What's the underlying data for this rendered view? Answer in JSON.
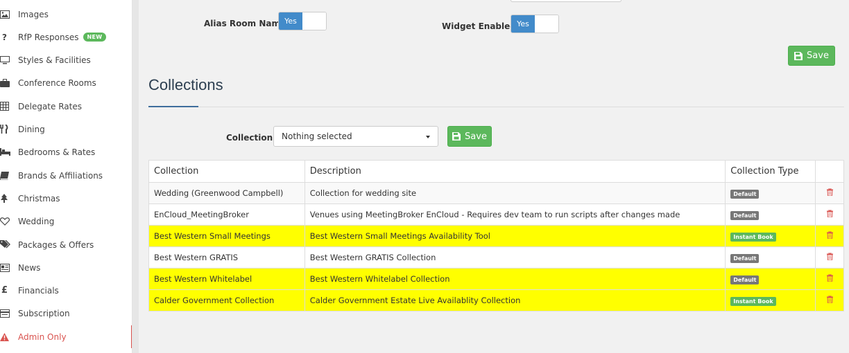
{
  "sidebar": {
    "items": [
      {
        "label": "Images",
        "icon": "image-icon"
      },
      {
        "label": "RfP Responses",
        "icon": "question-icon",
        "badge": "NEW"
      },
      {
        "label": "Styles & Facilities",
        "icon": "monitor-icon"
      },
      {
        "label": "Conference Rooms",
        "icon": "briefcase-icon"
      },
      {
        "label": "Delegate Rates",
        "icon": "calendar-grid-icon"
      },
      {
        "label": "Dining",
        "icon": "cutlery-icon"
      },
      {
        "label": "Bedrooms & Rates",
        "icon": "bed-icon"
      },
      {
        "label": "Brands & Affiliations",
        "icon": "book-icon"
      },
      {
        "label": "Christmas",
        "icon": "tree-icon"
      },
      {
        "label": "Wedding",
        "icon": "heart-icon"
      },
      {
        "label": "Packages & Offers",
        "icon": "tags-icon"
      },
      {
        "label": "News",
        "icon": "newspaper-icon"
      },
      {
        "label": "Financials",
        "icon": "pound-icon"
      },
      {
        "label": "Subscription",
        "icon": "list-icon"
      },
      {
        "label": "Admin Only",
        "icon": "warning-icon",
        "active": true
      }
    ]
  },
  "settings": {
    "alias_room_name_label": "Alias Room Name",
    "alias_room_name_value": "Yes",
    "widget_enabled_label": "Widget Enabled",
    "widget_enabled_value": "Yes",
    "save_label": "Save"
  },
  "collections": {
    "title": "Collections",
    "select_label": "Collection",
    "select_value": "Nothing selected",
    "save_label": "Save",
    "table": {
      "headers": [
        "Collection",
        "Description",
        "Collection Type"
      ],
      "rows": [
        {
          "collection": "Wedding (Greenwood Campbell)",
          "description": "Collection for wedding site",
          "type": "Default",
          "highlight": false
        },
        {
          "collection": "EnCloud_MeetingBroker",
          "description": "Venues using MeetingBroker EnCloud - Requires dev team to run scripts after changes made",
          "type": "Default",
          "highlight": false
        },
        {
          "collection": "Best Western Small Meetings",
          "description": "Best Western Small Meetings Availability Tool",
          "type": "Instant Book",
          "highlight": true
        },
        {
          "collection": "Best Western GRATIS",
          "description": "Best Western GRATIS Collection",
          "type": "Default",
          "highlight": false
        },
        {
          "collection": "Best Western Whitelabel",
          "description": "Best Western Whitelabel Collection",
          "type": "Default",
          "highlight": true
        },
        {
          "collection": "Calder Government Collection",
          "description": "Calder Government Estate Live Availablity Collection",
          "type": "Instant Book",
          "highlight": true
        }
      ]
    }
  },
  "colors": {
    "primary": "#428bca",
    "success": "#5cb85c",
    "danger": "#d9534f",
    "highlight": "#ffff00",
    "badge_default": "#777777"
  }
}
